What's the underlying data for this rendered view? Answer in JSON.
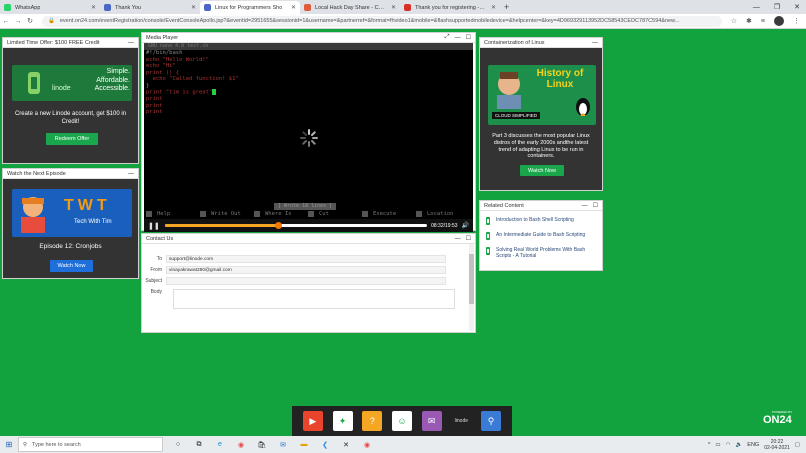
{
  "browser": {
    "tabs": [
      {
        "label": "WhatsApp",
        "color": "#25d366",
        "active": false
      },
      {
        "label": "Thank You",
        "color": "#4a67c6",
        "active": false
      },
      {
        "label": "Linux for Programmers Sho",
        "color": "#4a67c6",
        "active": true
      },
      {
        "label": "Local Hack Day Share - Challeng",
        "color": "#e25a3c",
        "active": false
      },
      {
        "label": "Thank you for registering - onco",
        "color": "#d93025",
        "active": false
      }
    ],
    "url": "event.on24.com/eventRegistration/console/EventConsoleApollo.jsp?&eventid=2951655&sessionid=1&username=&partnerref=&format=fhvideo1&mobile=&flashsupportedmobiledevice=&helpcenter=&key=4D969329113952DC58543CEDC787C594&new..."
  },
  "linode_panel": {
    "title": "Limited Time Offer: $100 FREE Credit",
    "banner_brand": "linode",
    "banner_tagline": "Simple. Affordable. Accessible.",
    "text": "Create a new Linode account, get $100 in Credit!",
    "button": "Redeem Offer"
  },
  "episode_panel": {
    "title": "Watch the Next Episode",
    "banner_brand": "TWT",
    "banner_sub": "Tech With Tim",
    "text": "Episode 12: Cronjobs",
    "button": "Watch Now"
  },
  "media_player": {
    "title": "Media Player",
    "terminal_header": "GNU nano 4.8                 test.sh",
    "lines": [
      {
        "text": "#!/bin/bash",
        "cls": ""
      },
      {
        "text": "",
        "cls": ""
      },
      {
        "text": "echo \"Hello World!\"",
        "cls": ""
      },
      {
        "text": "echo \"Hi\"",
        "cls": ""
      },
      {
        "text": "",
        "cls": ""
      },
      {
        "text": "print () {",
        "cls": ""
      },
      {
        "text": "  echo \"Called function! $1\"",
        "cls": ""
      },
      {
        "text": "}",
        "cls": ""
      },
      {
        "text": "",
        "cls": ""
      },
      {
        "text": "print \"tim is great\"",
        "cls": "cursor"
      },
      {
        "text": "print",
        "cls": ""
      },
      {
        "text": "print",
        "cls": ""
      },
      {
        "text": "print",
        "cls": ""
      }
    ],
    "status": "[ Wrote 18 lines ]",
    "keys": [
      {
        "label": "Help"
      },
      {
        "label": "Write Out"
      },
      {
        "label": "Where Is"
      },
      {
        "label": "Cut"
      },
      {
        "label": "Execute"
      },
      {
        "label": "Location"
      }
    ],
    "time": "08:32/19:53",
    "progress": 0.43
  },
  "contact": {
    "title": "Contact Us",
    "to_label": "To",
    "to_value": "support@linode.com",
    "from_label": "From",
    "from_value": "vinayakrawat280@gmail.com",
    "subject_label": "Subject",
    "subject_value": "",
    "body_label": "Body"
  },
  "containerization_panel": {
    "title": "Containerization of Linux",
    "banner_title": "History of Linux",
    "banner_sub": "CLOUD SIMPLIFIED",
    "text": "Part 3 discusses the most popular Linux distros of the early 2000s andthe latest trend of adapting Linux to be run in containers.",
    "button": "Watch Now"
  },
  "related": {
    "title": "Related Content",
    "items": [
      {
        "label": "Introduction to Bash Shell Scripting"
      },
      {
        "label": "An Intermediate Guide to Bash Scripting"
      },
      {
        "label": "Solving Real World Problems With Bash Scripts - A Tutorial"
      }
    ]
  },
  "dock": {
    "items": [
      {
        "icon": "media-player-icon",
        "color": "#e8452c",
        "glyph": "▶"
      },
      {
        "icon": "linode-icon",
        "color": "#ffffff",
        "glyph": "✦"
      },
      {
        "icon": "help-icon",
        "color": "#f5a623",
        "glyph": "?"
      },
      {
        "icon": "speaker-icon",
        "color": "#ffffff",
        "glyph": "☺"
      },
      {
        "icon": "email-icon",
        "color": "#9b59b6",
        "glyph": "✉"
      },
      {
        "icon": "linode-logo-icon",
        "color": "#222222",
        "glyph": "linode"
      },
      {
        "icon": "resources-icon",
        "color": "#3a7bd5",
        "glyph": "⚲"
      }
    ]
  },
  "on24": {
    "label": "ON24",
    "small": "POWERED BY"
  },
  "taskbar": {
    "search_placeholder": "Type here to search",
    "lang": "ENG",
    "time": "20:22",
    "date": "02-04-2021"
  }
}
